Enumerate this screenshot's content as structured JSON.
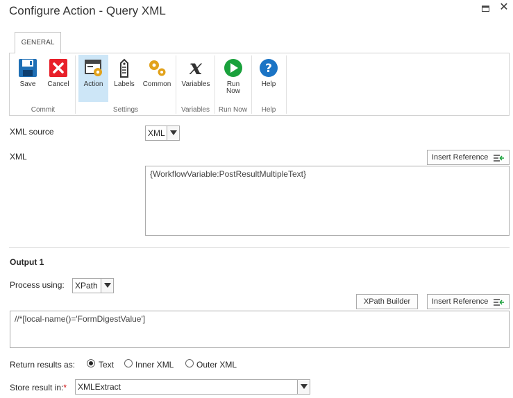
{
  "window": {
    "title": "Configure Action - Query XML"
  },
  "ribbon": {
    "tab": "GENERAL",
    "buttons": {
      "save": "Save",
      "cancel": "Cancel",
      "action": "Action",
      "labels": "Labels",
      "common": "Common",
      "variables": "Variables",
      "run_now_line1": "Run",
      "run_now_line2": "Now",
      "help": "Help"
    },
    "groups": {
      "commit": "Commit",
      "settings": "Settings",
      "variables": "Variables",
      "run_now": "Run Now",
      "help": "Help"
    }
  },
  "form": {
    "xml_source_label": "XML source",
    "xml_source_value": "XML",
    "xml_label": "XML",
    "insert_reference": "Insert Reference",
    "xml_value": "{WorkflowVariable:PostResultMultipleText}",
    "output_heading": "Output 1",
    "process_using_label": "Process using:",
    "process_using_value": "XPath",
    "xpath_builder": "XPath Builder",
    "insert_reference_2": "Insert Reference",
    "xpath_value": "//*[local-name()='FormDigestValue']",
    "return_results_label": "Return results as:",
    "return_options": [
      "Text",
      "Inner XML",
      "Outer XML"
    ],
    "return_selected": "Text",
    "store_result_label": "Store result in:",
    "required_mark": "*",
    "store_result_value": "XMLExtract"
  },
  "colors": {
    "save_blue": "#1f6fb5",
    "cancel_red": "#e8202a",
    "run_green": "#1aa13c",
    "help_blue": "#1b74c5",
    "active_bg": "#cde6f7",
    "required": "#cc0000"
  },
  "icons": [
    "floppy-icon",
    "close-x-icon",
    "action-gear-icon",
    "tag-icon",
    "gears-icon",
    "variable-x-icon",
    "play-icon",
    "question-icon",
    "insert-reference-icon",
    "maximize-icon",
    "close-icon"
  ]
}
